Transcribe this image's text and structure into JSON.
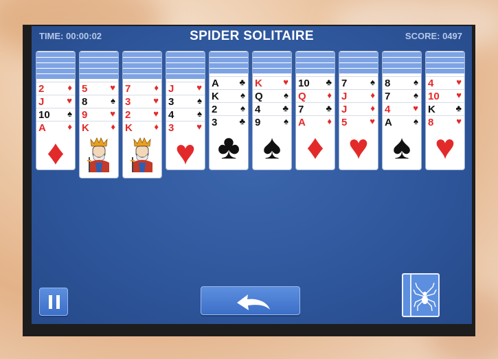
{
  "header": {
    "time_label": "TIME: 00:00:02",
    "title": "SPIDER SOLITAIRE",
    "score_label": "SCORE: 0497"
  },
  "colors": {
    "table": "#2f579c",
    "card_back": "#7ea3e4",
    "red_suit": "#e32a2a"
  },
  "tableau": [
    {
      "down": 5,
      "cards": [
        [
          "2",
          "diamond"
        ],
        [
          "J",
          "heart"
        ],
        [
          "10",
          "spade"
        ],
        [
          "A",
          "diamond"
        ]
      ],
      "big": "diamond"
    },
    {
      "down": 5,
      "cards": [
        [
          "5",
          "heart"
        ],
        [
          "8",
          "spade"
        ],
        [
          "9",
          "heart"
        ],
        [
          "K",
          "diamond"
        ]
      ],
      "big": "king"
    },
    {
      "down": 5,
      "cards": [
        [
          "7",
          "diamond"
        ],
        [
          "3",
          "heart"
        ],
        [
          "2",
          "heart"
        ],
        [
          "K",
          "diamond"
        ]
      ],
      "big": "king"
    },
    {
      "down": 5,
      "cards": [
        [
          "J",
          "heart"
        ],
        [
          "3",
          "spade"
        ],
        [
          "4",
          "spade"
        ],
        [
          "3",
          "heart"
        ]
      ],
      "big": "heart"
    },
    {
      "down": 4,
      "cards": [
        [
          "A",
          "club"
        ],
        [
          "K",
          "spade"
        ],
        [
          "2",
          "spade"
        ],
        [
          "3",
          "club"
        ]
      ],
      "big": "club"
    },
    {
      "down": 4,
      "cards": [
        [
          "K",
          "heart"
        ],
        [
          "Q",
          "spade"
        ],
        [
          "4",
          "club"
        ],
        [
          "9",
          "spade"
        ]
      ],
      "big": "spade"
    },
    {
      "down": 4,
      "cards": [
        [
          "10",
          "club"
        ],
        [
          "Q",
          "diamond"
        ],
        [
          "7",
          "club"
        ],
        [
          "A",
          "diamond"
        ]
      ],
      "big": "diamond"
    },
    {
      "down": 4,
      "cards": [
        [
          "7",
          "spade"
        ],
        [
          "J",
          "diamond"
        ],
        [
          "J",
          "diamond"
        ],
        [
          "5",
          "heart"
        ]
      ],
      "big": "heart"
    },
    {
      "down": 4,
      "cards": [
        [
          "8",
          "spade"
        ],
        [
          "7",
          "spade"
        ],
        [
          "4",
          "heart"
        ],
        [
          "A",
          "spade"
        ]
      ],
      "big": "spade"
    },
    {
      "down": 4,
      "cards": [
        [
          "4",
          "heart"
        ],
        [
          "10",
          "heart"
        ],
        [
          "K",
          "club"
        ],
        [
          "8",
          "heart"
        ]
      ],
      "big": "heart"
    }
  ],
  "controls": {
    "pause_icon": "pause-icon",
    "undo_icon": "undo-arrow-icon",
    "stock_icon": "spider-icon"
  }
}
